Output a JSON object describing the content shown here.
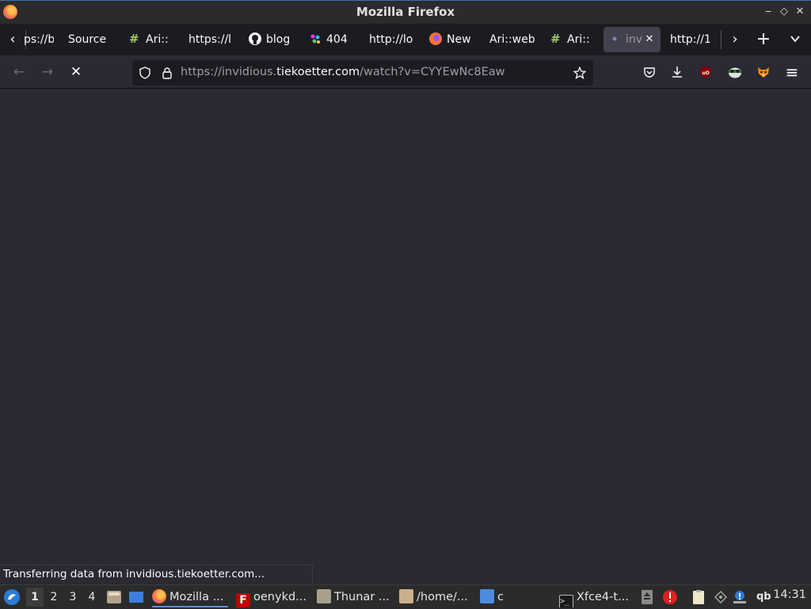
{
  "window": {
    "title": "Mozilla Firefox",
    "controls": {
      "minimize": "‒",
      "maximize": "◇",
      "close": "✕"
    }
  },
  "tabs": [
    {
      "label": "ps://b",
      "icon": "none"
    },
    {
      "label": "Source",
      "icon": "none"
    },
    {
      "label": "Ari::",
      "icon": "hash-icon"
    },
    {
      "label": "https://l",
      "icon": "none"
    },
    {
      "label": "blog",
      "icon": "github-icon"
    },
    {
      "label": "404",
      "icon": "colorful-icon"
    },
    {
      "label": "http://lo",
      "icon": "none"
    },
    {
      "label": "New",
      "icon": "firefox-icon"
    },
    {
      "label": "Ari::web",
      "icon": "none"
    },
    {
      "label": "Ari::",
      "icon": "hash-icon"
    },
    {
      "label": "inv",
      "icon": "loading-dot-icon",
      "active": true
    },
    {
      "label": "http://1",
      "icon": "none"
    }
  ],
  "tabstrip": {
    "scroll_left": "‹",
    "scroll_right": "›",
    "new_tab": "+",
    "list_all": "⌄"
  },
  "navbar": {
    "back": "←",
    "forward": "→",
    "stop": "✕",
    "url_prefix": "https://invidious.",
    "url_host": "tiekoetter.com",
    "url_path": "/watch?v=CYYEwNc8Eaw",
    "toolbar_icons": [
      "pocket-icon",
      "download-icon",
      "ublock-icon",
      "privacy-badger-icon",
      "extension-fox-icon",
      "menu-icon"
    ],
    "menu_glyph": "≡"
  },
  "status": {
    "text": "Transferring data from invidious.tiekoetter.com..."
  },
  "taskbar": {
    "workspaces": [
      "1",
      "2",
      "3",
      "4"
    ],
    "active_workspace": "1",
    "tasks": [
      {
        "label": "Mozilla ...",
        "icon": "firefox-icon",
        "active": true
      },
      {
        "label": "oenykd...",
        "icon": "filezilla-icon"
      },
      {
        "label": "Thunar ...",
        "icon": "thunar-icon"
      },
      {
        "label": "/home/...",
        "icon": "archive-icon"
      },
      {
        "label": "c",
        "icon": "folder-icon"
      },
      {
        "label": "Xfce4-t...",
        "icon": "terminal-icon"
      }
    ],
    "tray_text": "qb",
    "clock": "14:31"
  },
  "colors": {
    "accent": "#5a8fd0",
    "background": "#2b2a33",
    "toolbar": "#1c1b22"
  }
}
